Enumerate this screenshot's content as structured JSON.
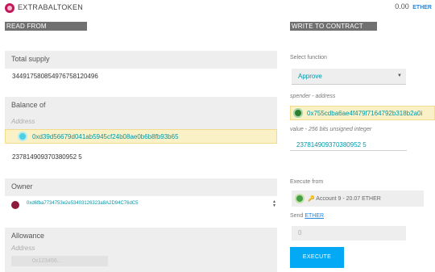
{
  "header": {
    "title": "EXTRABALTOKEN",
    "balance_value": "0.00",
    "balance_unit": "ETHER"
  },
  "read": {
    "section_title": "READ FROM CONTRACT",
    "total_supply": {
      "label": "Total supply",
      "value": "344917580854976758120496"
    },
    "balance_of": {
      "label": "Balance of",
      "param_label": "Address",
      "address": "0xd39d56679d041ab5945cf24b08ae0b6b8fb93b65",
      "value": "237814909370380952 5"
    },
    "owner": {
      "label": "Owner",
      "address": "0xd6fba7734753e2e53403126323a8A2D94C76dC5"
    },
    "allowance": {
      "label": "Allowance",
      "param_label": "Address",
      "placeholder": "0x123456..."
    }
  },
  "write": {
    "section_title": "WRITE TO CONTRACT",
    "select_function_label": "Select function",
    "selected_function": "Approve",
    "spender_label": "spender - address",
    "spender_address": "0x755cdba6ae4f479f7164792b318b2a0i",
    "value_label": "value - 256 bits unsigned integer",
    "value": "237814909370380952 5",
    "execute_from_label": "Execute from",
    "execute_from_account": "🔑 Account 9 - 20.07 ETHER",
    "send_label": "Send",
    "send_unit": "ETHER",
    "send_value": "0",
    "execute_button": "EXECUTE"
  },
  "colors": {
    "accent": "#03a9f4",
    "address_text": "#0097a7",
    "highlight_bg": "#fbf1c7",
    "section_header_bg": "#707070"
  }
}
